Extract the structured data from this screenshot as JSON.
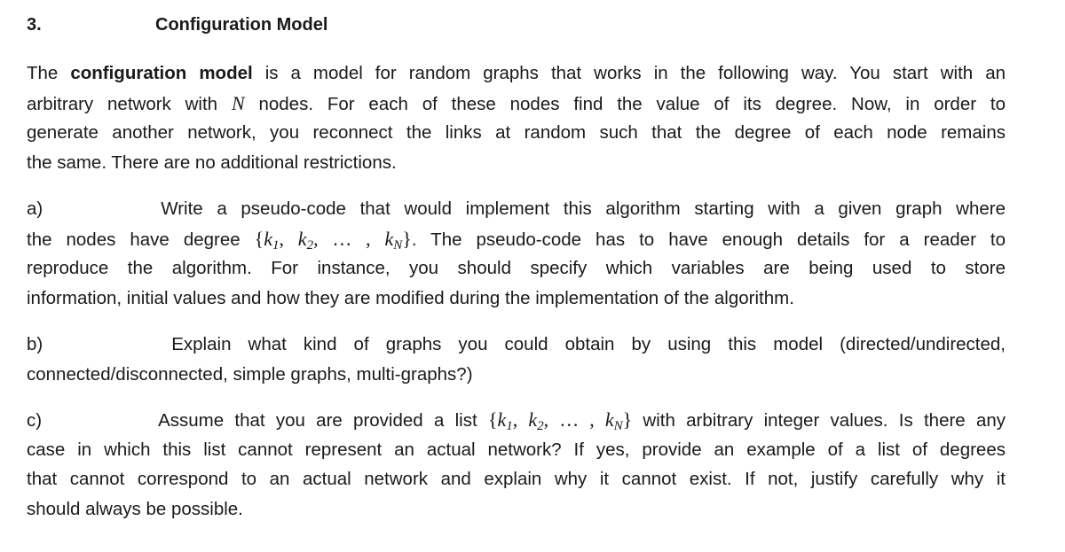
{
  "heading": {
    "number": "3.",
    "title": "Configuration Model"
  },
  "intro": {
    "lead": "The ",
    "bold_term": "configuration model",
    "line1_rest": " is a model for random graphs that works in the following way. You start with an",
    "line2_pre": "arbitrary network with ",
    "line2_var": "N",
    "line2_post": " nodes. For each of these nodes find the value of its degree. Now, in order to",
    "line3": "generate another network, you reconnect the links at random such that the degree of each node remains",
    "line4": "the same. There are no additional restrictions."
  },
  "degree_set": {
    "open": "{",
    "k": "k",
    "sub1": "1",
    "sub2": "2",
    "ellipsis": ", … , ",
    "subN": "N",
    "close": "}",
    "comma": ", "
  },
  "part_a": {
    "label": "a)",
    "line1": "Write a pseudo-code that would implement this algorithm starting with a given graph where",
    "line2_pre": "the nodes have degree ",
    "line2_post": ". The pseudo-code has to have enough details for a reader to",
    "line3": "reproduce the algorithm. For instance, you should specify which variables are being used to store",
    "line4": "information, initial values and how they are modified during the implementation of the algorithm."
  },
  "part_b": {
    "label": "b)",
    "line1": "Explain what kind of graphs you could obtain by using this model (directed/undirected,",
    "line2": "connected/disconnected, simple graphs, multi-graphs?)"
  },
  "part_c": {
    "label": "c)",
    "line1_pre": "Assume that you are provided a list ",
    "line1_post": " with arbitrary integer values. Is there any",
    "line2": "case in which this list cannot represent an actual network? If yes, provide an example of a list of degrees",
    "line3": "that cannot correspond to an actual network and explain why it cannot exist. If not, justify carefully why it",
    "line4": "should always be possible."
  }
}
